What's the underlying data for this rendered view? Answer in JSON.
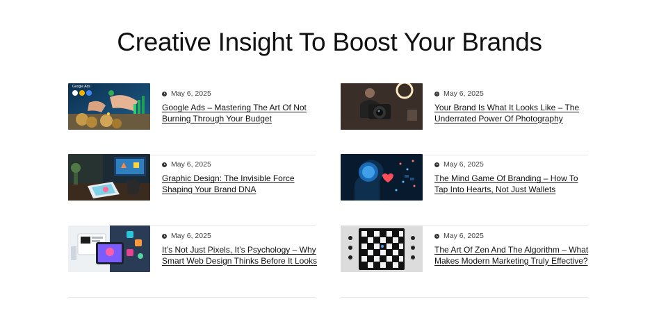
{
  "section": {
    "title": "Creative Insight To Boost Your Brands"
  },
  "posts": [
    {
      "date": "May 6, 2025",
      "title": "Google Ads – Mastering The Art Of Not Burning Through Your Budget",
      "thumb_label": "Google Ads"
    },
    {
      "date": "May 6, 2025",
      "title": "Your Brand Is What It Looks Like – The Underrated Power Of Photography"
    },
    {
      "date": "May 6, 2025",
      "title": "Graphic Design: The Invisible Force Shaping Your Brand DNA"
    },
    {
      "date": "May 6, 2025",
      "title": "The Mind Game Of Branding – How To Tap Into Hearts, Not Just Wallets"
    },
    {
      "date": "May 6, 2025",
      "title": "It’s Not Just Pixels, It’s Psychology – Why Smart Web Design Thinks Before It Looks"
    },
    {
      "date": "May 6, 2025",
      "title": "The Art Of Zen And The Algorithm – What Makes Modern Marketing Truly Effective?"
    }
  ],
  "colors": {
    "text": "#111111",
    "meta": "#444444",
    "divider": "#e6e6e6",
    "background": "#ffffff"
  },
  "icons": {
    "date": "clock-icon"
  }
}
